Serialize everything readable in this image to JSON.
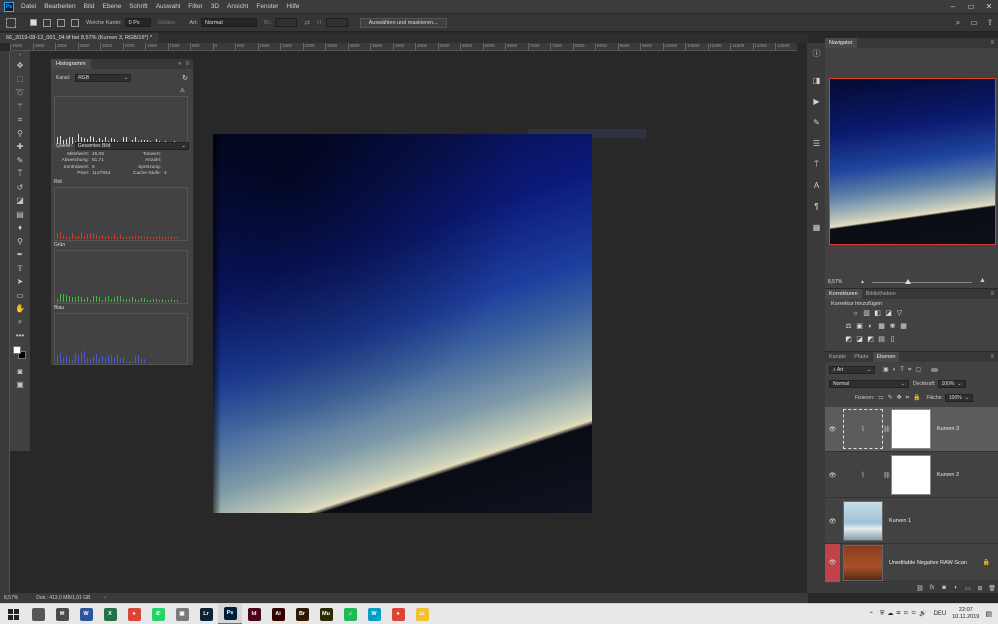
{
  "menubar": {
    "items": [
      "Datei",
      "Bearbeiten",
      "Bild",
      "Ebene",
      "Schrift",
      "Auswahl",
      "Filter",
      "3D",
      "Ansicht",
      "Fenster",
      "Hilfe"
    ]
  },
  "options": {
    "soft_edge_label": "Weiche Kante:",
    "soft_edge_value": "0 Px",
    "smooth_label": "Glätten",
    "style_label": "Art:",
    "style_value": "Normal",
    "width_label": "Br.:",
    "height_label": "H:",
    "select_mask_button": "Auswählen und maskieren..."
  },
  "document": {
    "tab_title": "66_2019-08-12_001_04.tif bei 8,57% (Kurven 3, RGB/16*) *",
    "ruler_ticks": [
      "4500",
      "4000",
      "3500",
      "3000",
      "2500",
      "2000",
      "1500",
      "1000",
      "500",
      "0",
      "500",
      "1000",
      "1500",
      "2000",
      "2500",
      "3000",
      "3500",
      "4000",
      "4500",
      "5000",
      "5500",
      "6000",
      "6500",
      "7000",
      "7500",
      "8000",
      "8500",
      "9000",
      "9500",
      "10000",
      "10500",
      "11000",
      "11500",
      "12000",
      "12500"
    ]
  },
  "histogram": {
    "tab": "Histogramm",
    "channel_label": "Kanal:",
    "channel_value": "RGB",
    "source_label": "Quelle:",
    "source_value": "Gesamtes Bild",
    "stats_left": [
      {
        "k": "Mittelwert:",
        "v": "45,06"
      },
      {
        "k": "Abweichung:",
        "v": "61,71"
      },
      {
        "k": "Zentralwert:",
        "v": "8"
      },
      {
        "k": "Pixel:",
        "v": "1127844"
      }
    ],
    "stats_right": [
      {
        "k": "Tonwert:",
        "v": ""
      },
      {
        "k": "Anzahl:",
        "v": ""
      },
      {
        "k": "Spreizung:",
        "v": ""
      },
      {
        "k": "Cache-Stufe:",
        "v": "4"
      }
    ],
    "channels": [
      "Rot",
      "Grün",
      "Blau"
    ]
  },
  "navigator": {
    "tab": "Navigator",
    "zoom": "8,57%"
  },
  "adjustments": {
    "tabs": [
      "Korrekturen",
      "Bibliotheken"
    ],
    "hint": "Korrektur hinzufügen",
    "row1": [
      "☼",
      "▥",
      "◧",
      "◪",
      "▽"
    ],
    "row2": [
      "⚖",
      "▣",
      "◐",
      "▦",
      "❀",
      "▦"
    ],
    "row3": [
      "◩",
      "◪",
      "◩",
      "▤",
      "▯"
    ]
  },
  "layers": {
    "tabs": [
      "Kanäle",
      "Pfade",
      "Ebenen"
    ],
    "filter_label": "Art",
    "blend_mode": "Normal",
    "opacity_label": "Deckkraft:",
    "opacity_value": "100%",
    "lock_label": "Fixieren:",
    "fill_label": "Fläche:",
    "fill_value": "100%",
    "items": [
      {
        "name": "Kurven 3"
      },
      {
        "name": "Kurven 2"
      },
      {
        "name": "Kurven 1"
      },
      {
        "name": "Uneditable Negative RAW-Scan"
      }
    ]
  },
  "status": {
    "zoom": "8,57%",
    "doc": "Dok.: 413,0 MB/1,01 GB"
  },
  "taskbar": {
    "apps": [
      {
        "label": "",
        "color": "#555555"
      },
      {
        "label": "✉",
        "color": "#4a4a4a"
      },
      {
        "label": "W",
        "color": "#2b579a"
      },
      {
        "label": "X",
        "color": "#217346"
      },
      {
        "label": "●",
        "color": "#db4437"
      },
      {
        "label": "✆",
        "color": "#25d366"
      },
      {
        "label": "▣",
        "color": "#7a7a7a"
      },
      {
        "label": "Lr",
        "color": "#0b2233"
      },
      {
        "label": "Ps",
        "color": "#001e36"
      },
      {
        "label": "Id",
        "color": "#49021f"
      },
      {
        "label": "Ai",
        "color": "#330000"
      },
      {
        "label": "Br",
        "color": "#2e1a00"
      },
      {
        "label": "Mu",
        "color": "#2a2a00"
      },
      {
        "label": "♫",
        "color": "#1db954"
      },
      {
        "label": "W",
        "color": "#00a0c6"
      },
      {
        "label": "●",
        "color": "#db4437"
      },
      {
        "label": "▭",
        "color": "#f2c12e"
      }
    ],
    "lang": "DEU",
    "time": "22:07",
    "date": "10.11.2019"
  }
}
